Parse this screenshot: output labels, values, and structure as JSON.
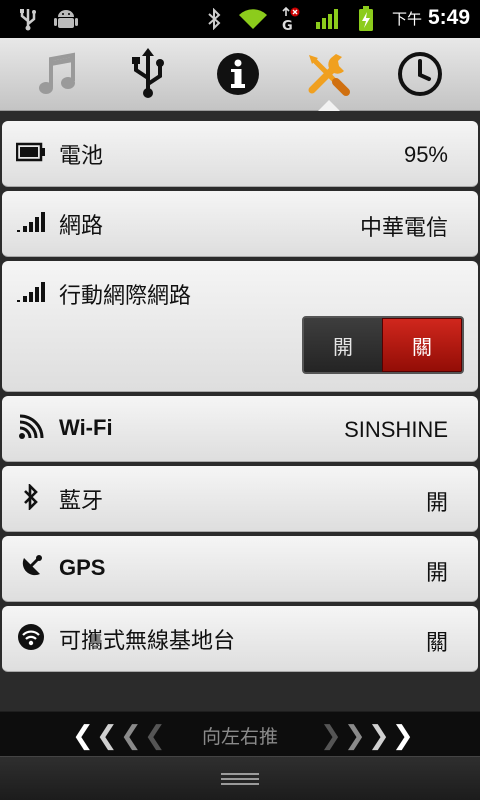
{
  "status_bar": {
    "ampm": "下午",
    "time": "5:49",
    "icons": [
      "usb-debug-icon",
      "android-icon",
      "bluetooth-icon",
      "wifi-signal-icon",
      "mobile-data-g-icon",
      "cell-signal-icon",
      "battery-charging-icon"
    ]
  },
  "tabs": [
    {
      "name": "music-icon"
    },
    {
      "name": "usb-icon"
    },
    {
      "name": "info-icon"
    },
    {
      "name": "tools-icon",
      "selected": true
    },
    {
      "name": "clock-icon"
    }
  ],
  "rows": {
    "battery": {
      "label": "電池",
      "value": "95%",
      "icon": "battery-icon"
    },
    "network": {
      "label": "網路",
      "value": "中華電信",
      "icon": "signal-bars-icon"
    },
    "mobile_data": {
      "label": "行動網際網路",
      "icon": "signal-bars-icon",
      "toggle_on": "開",
      "toggle_off": "關",
      "state": "off"
    },
    "wifi": {
      "label": "Wi-Fi",
      "value": "SINSHINE",
      "icon": "wifi-icon"
    },
    "bluetooth": {
      "label": "藍牙",
      "value": "開",
      "icon": "bluetooth-icon"
    },
    "gps": {
      "label": "GPS",
      "value": "開",
      "icon": "gps-icon"
    },
    "hotspot": {
      "label": "可攜式無線基地台",
      "value": "關",
      "icon": "hotspot-icon"
    }
  },
  "swipe_hint": "向左右推",
  "colors": {
    "accent_orange": "#f0a020",
    "toggle_red": "#c41a10",
    "signal_green": "#8ccc1c"
  }
}
